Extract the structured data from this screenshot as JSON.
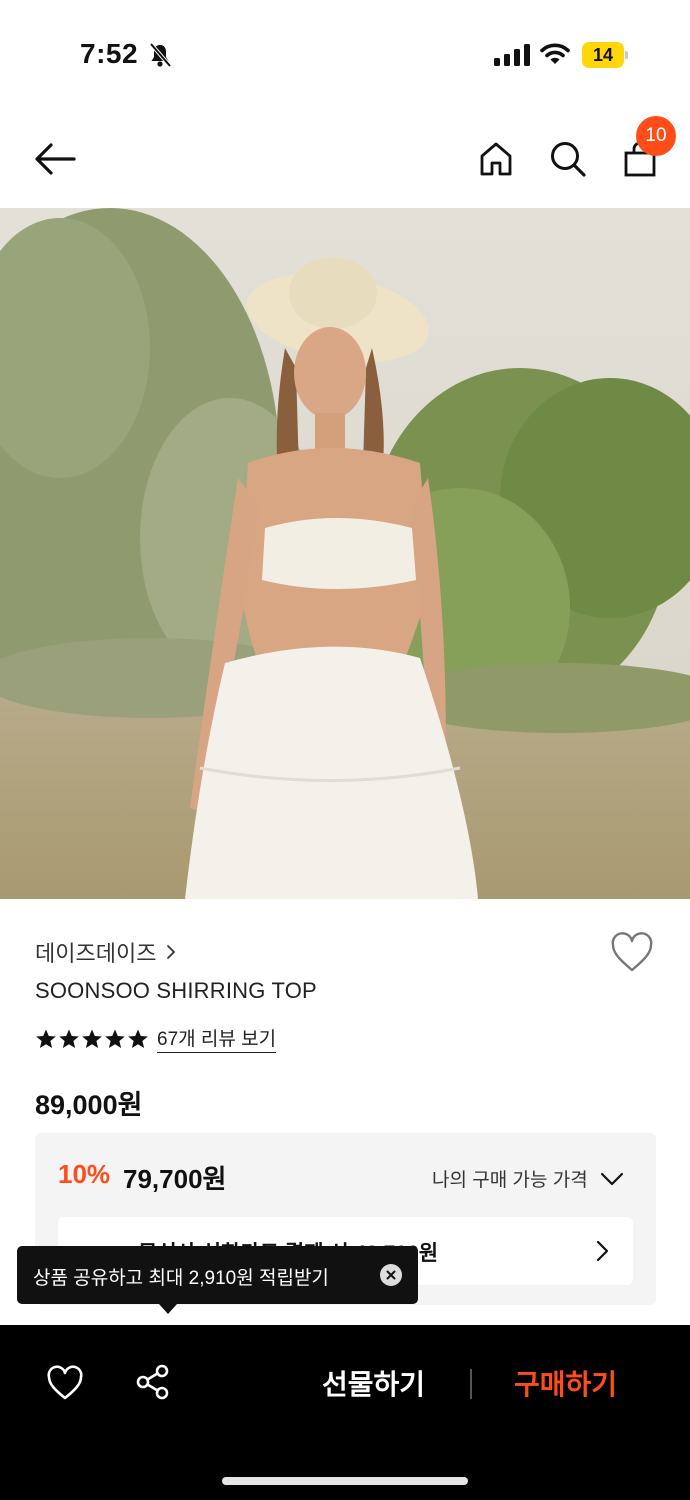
{
  "status_bar": {
    "time": "7:52",
    "battery": "14"
  },
  "header": {
    "cart_count": "10"
  },
  "product": {
    "brand": "데이즈데이즈",
    "name": "SOONSOO SHIRRING TOP",
    "rating_stars": 5,
    "review_link": "67개 리뷰 보기",
    "price": "89,000원"
  },
  "price_box": {
    "discount": "10%",
    "sale_price": "79,700원",
    "my_price_label": "나의 구매 가능 가격",
    "card_offer": "무신사 신한카드 결제 시 49,700원"
  },
  "tooltip": {
    "text": "상품 공유하고 최대 2,910원 적립받기"
  },
  "bottom_bar": {
    "gift_label": "선물하기",
    "buy_label": "구매하기"
  },
  "colors": {
    "accent": "#ff4d1a",
    "battery": "#ffd60a",
    "price_box_bg": "#f4f4f4",
    "bottom_bar_bg": "#000000"
  }
}
